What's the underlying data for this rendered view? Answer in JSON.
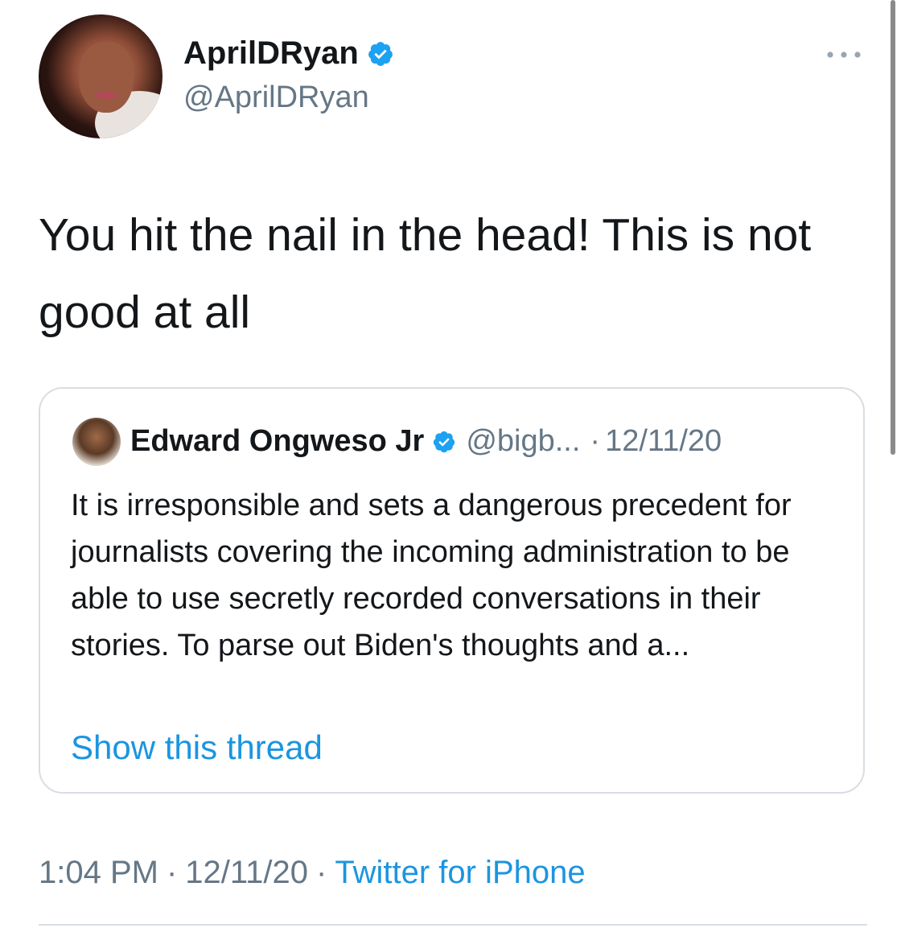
{
  "colors": {
    "text": "#14171a",
    "secondary": "#657786",
    "link": "#1b95e0",
    "verified": "#1da1f2",
    "border": "#d8dee3"
  },
  "tweet": {
    "author_name": "AprilDRyan",
    "author_handle": "@AprilDRyan",
    "text": "You hit the nail in the head! This is not good at all",
    "more_icon": "more-dots-icon",
    "verified_icon": "verified-badge-icon"
  },
  "quoted_tweet": {
    "author_name": "Edward Ongweso Jr",
    "author_handle": "@bigb...",
    "separator": "·",
    "date": "12/11/20",
    "text": "It is irresponsible and sets a dangerous precedent for journalists covering the incoming administration to be able to use secretly recorded conversations in their stories. To parse out Biden's thoughts and a...",
    "show_thread_label": "Show this thread"
  },
  "meta": {
    "time": "1:04 PM",
    "separator": "·",
    "date": "12/11/20",
    "source": "Twitter for iPhone"
  }
}
